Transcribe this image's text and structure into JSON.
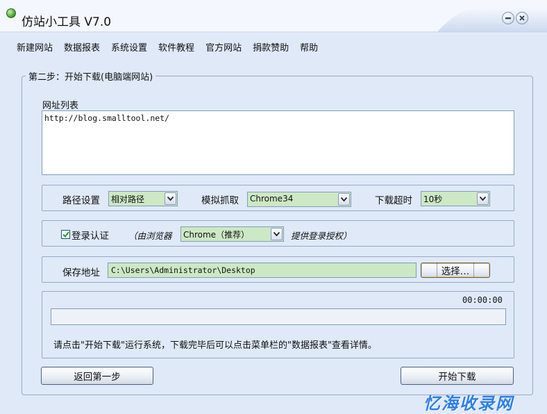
{
  "window": {
    "title": "仿站小工具 V7.0",
    "minimize_icon": "minimize-icon",
    "close_icon": "close-icon"
  },
  "menu": {
    "items": [
      "新建网站",
      "数据报表",
      "系统设置",
      "软件教程",
      "官方网站",
      "捐款赞助",
      "帮助"
    ]
  },
  "group": {
    "title": "第二步：开始下载(电脑端网站)"
  },
  "url_list": {
    "label": "网址列表",
    "value": "http://blog.smalltool.net/"
  },
  "options": {
    "path_label": "路径设置",
    "path_value": "相对路径",
    "crawl_label": "模拟抓取",
    "crawl_value": "Chrome34",
    "timeout_label": "下载超时",
    "timeout_value": "10秒"
  },
  "login": {
    "checked": true,
    "label": "登录认证",
    "hint_before": "（由浏览器",
    "browser_value": "Chrome（推荐）",
    "hint_after": "提供登录授权）"
  },
  "save": {
    "label": "保存地址",
    "path": "C:\\Users\\Administrator\\Desktop",
    "choose_button": "选择…"
  },
  "progress": {
    "time": "00:00:00",
    "percent": 0,
    "hint": "请点击\"开始下载\"运行系统，下载完毕后可以点击菜单栏的\"数据报表\"查看详情。"
  },
  "buttons": {
    "back": "返回第一步",
    "start": "开始下载"
  },
  "watermark": "忆海收录网",
  "colors": {
    "background": "#dfe9f8",
    "combo_fill": "#cde8c4",
    "border": "#98a8c6",
    "watermark": "#2f7fe6"
  }
}
